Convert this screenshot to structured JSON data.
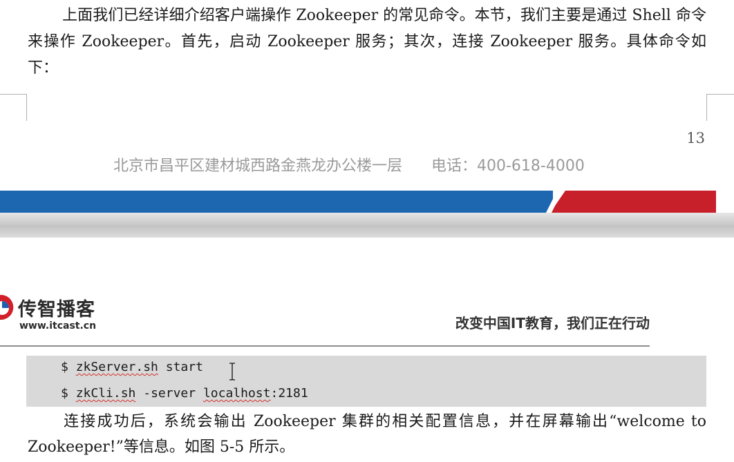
{
  "intro_paragraph": "上面我们已经详细介绍客户端操作 Zookeeper 的常见命令。本节，我们主要是通过 Shell 命令来操作 Zookeeper。首先，启动 Zookeeper 服务；其次，连接 Zookeeper 服务。具体命令如下：",
  "footer": {
    "page_number": "13",
    "address": "北京市昌平区建材城西路金燕龙办公楼一层",
    "phone": "电话：400-618-4000"
  },
  "header": {
    "brand_name": "传智播客",
    "brand_url": "www.itcast.cn",
    "slogan": "改变中国IT教育，我们正在行动"
  },
  "code": {
    "line1": {
      "prompt": "$ ",
      "command": "zkServer.sh",
      "args": " start"
    },
    "line2": {
      "prompt": "$ ",
      "command": "zkCli.sh",
      "middle": " -server ",
      "host": "localhost",
      "port": ":2181"
    }
  },
  "result_paragraph": "连接成功后，系统会输出 Zookeeper 集群的相关配置信息，并在屏幕输出“welcome to Zookeeper!”等信息。如图 5-5 所示。",
  "colors": {
    "stripe_blue": "#1d67b0",
    "stripe_red": "#c8202a",
    "logo_red": "#d21f2a",
    "logo_blue": "#1b5fb0"
  }
}
